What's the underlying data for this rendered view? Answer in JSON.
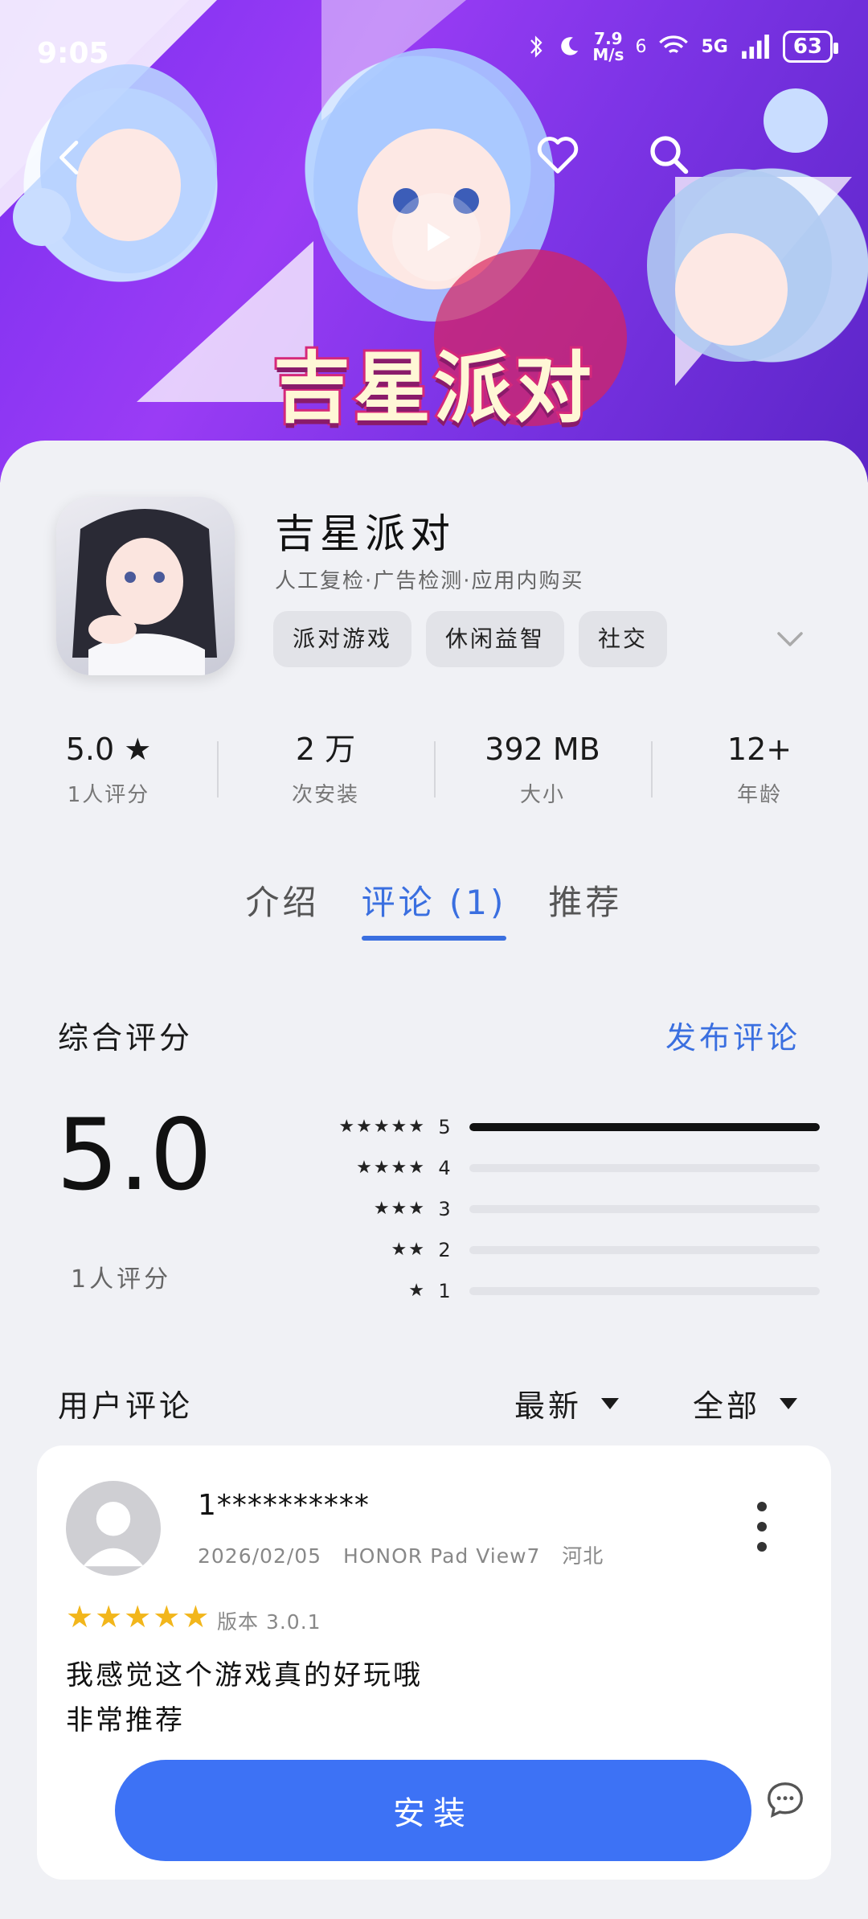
{
  "status_bar": {
    "time": "9:05",
    "net_speed_value": "7.9",
    "net_speed_unit": "M/s",
    "signal": "5G",
    "sim": "6",
    "battery": "63"
  },
  "hero": {
    "logo_text": "吉星派对"
  },
  "app": {
    "name": "吉星派对",
    "meta": "人工复检·广告检测·应用内购买",
    "tags": [
      "派对游戏",
      "休闲益智",
      "社交"
    ]
  },
  "stats": [
    {
      "value": "5.0 ★",
      "label": "1人评分"
    },
    {
      "value": "2 万",
      "label": "次安装"
    },
    {
      "value": "392 MB",
      "label": "大小"
    },
    {
      "value": "12+",
      "label": "年龄"
    }
  ],
  "tabs": [
    {
      "label": "介绍",
      "active": false
    },
    {
      "label": "评论 (1)",
      "active": true
    },
    {
      "label": "推荐",
      "active": false
    }
  ],
  "rating": {
    "title": "综合评分",
    "publish": "发布评论",
    "score": "5.0",
    "count": "1人评分",
    "distribution": [
      {
        "stars": "★★★★★",
        "level": "5",
        "fraction": 1.0
      },
      {
        "stars": "★★★★",
        "level": "4",
        "fraction": 0.0
      },
      {
        "stars": "★★★",
        "level": "3",
        "fraction": 0.0
      },
      {
        "stars": "★★",
        "level": "2",
        "fraction": 0.0
      },
      {
        "stars": "★",
        "level": "1",
        "fraction": 0.0
      }
    ]
  },
  "reviews_section": {
    "title": "用户评论",
    "sort": "最新",
    "filter": "全部"
  },
  "review": {
    "user": "1**********",
    "date": "2026/02/05",
    "device": "HONOR Pad View7",
    "location": "河北",
    "rating": 5,
    "version": "版本 3.0.1",
    "line1": "我感觉这个游戏真的好玩哦",
    "line2": "非常推荐"
  },
  "install_button": "安装",
  "colors": {
    "accent": "#3a6fe0",
    "install": "#3d72f5",
    "star": "#f2b61b"
  }
}
